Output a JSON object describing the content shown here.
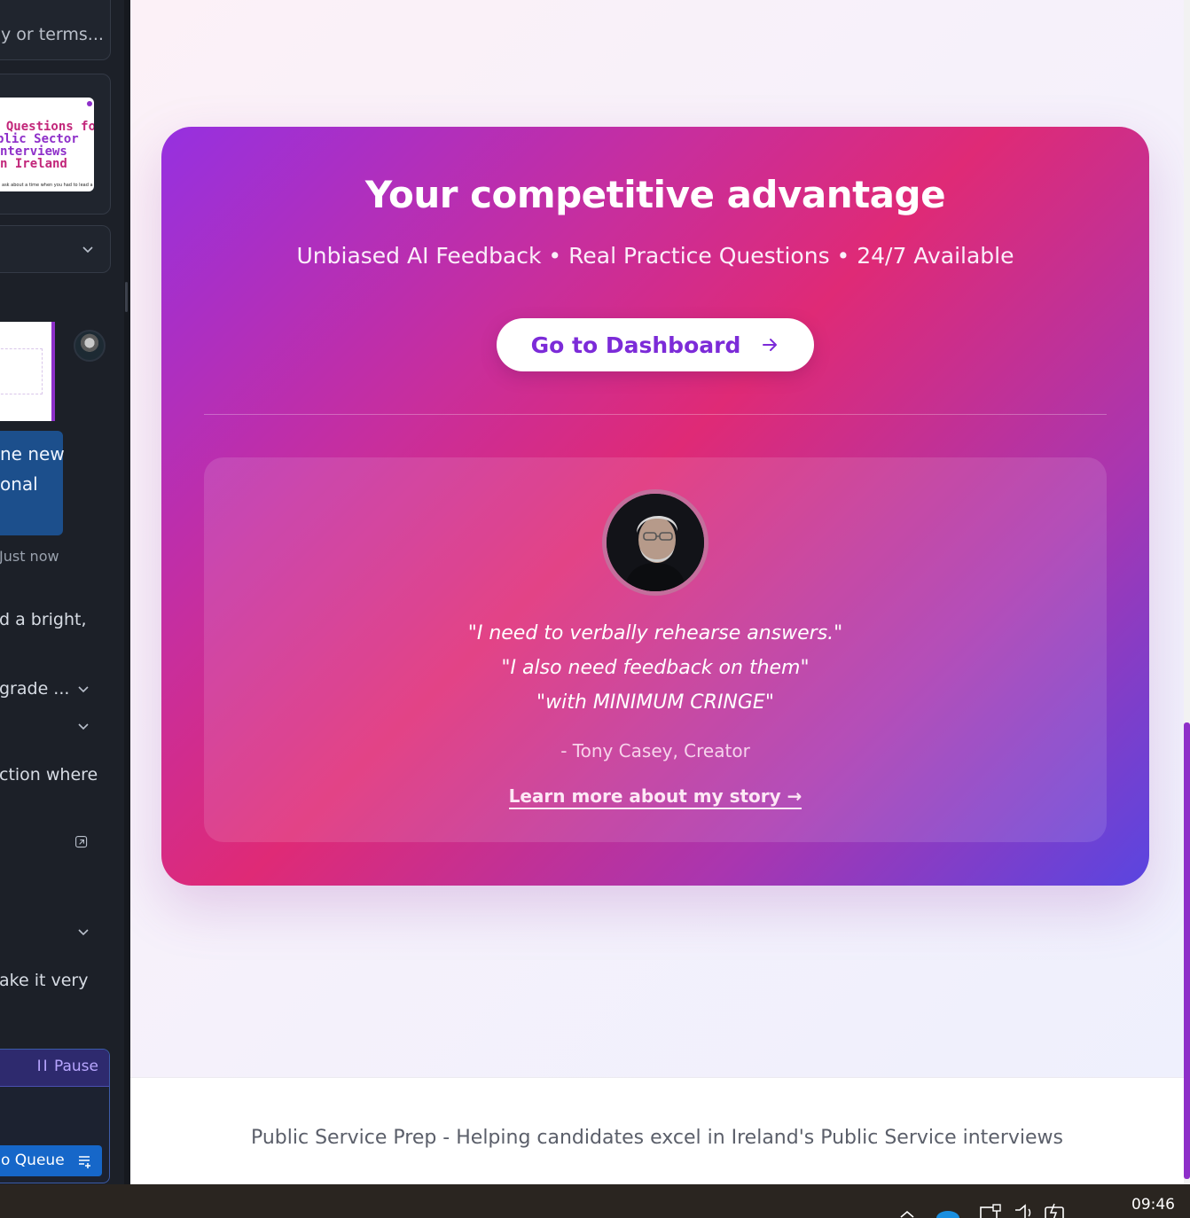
{
  "left_panel": {
    "search_fragment": "y or terms...",
    "thumbnail_lines": [
      "e Questions fo",
      "blic Sector",
      "nterviews",
      "n Ireland"
    ],
    "thumbnail_tiny": "ask about a time when you had to lead a",
    "bubble_lines": [
      "ne new",
      "onal"
    ],
    "bubble_time": "Just now",
    "text_bright": "d a bright,",
    "text_grade": "grade ...",
    "text_action": "ction where",
    "text_make": "ake it very",
    "pause_label": "Pause",
    "queue_label": "o Queue"
  },
  "cta": {
    "title": "Your competitive advantage",
    "subtitle": "Unbiased AI Feedback • Real Practice Questions • 24/7 Available",
    "button_label": "Go to Dashboard",
    "accent": "#7c2bd8",
    "gradient": [
      "#9630e0",
      "#df2a76",
      "#5a45e0"
    ]
  },
  "testimonial": {
    "quotes": [
      "\"I need to verbally rehearse answers.\"",
      "\"I also need feedback on them\"",
      "\"with MINIMUM CRINGE\""
    ],
    "attribution": "- Tony Casey, Creator",
    "link_label": "Learn more about my story →"
  },
  "footer": {
    "text": "Public Service Prep - Helping candidates excel in Ireland's Public Service interviews"
  },
  "taskbar": {
    "time": "09:46",
    "tray_icons": [
      "chevron-up-icon",
      "onedrive-icon",
      "network-icon",
      "volume-icon",
      "battery-charging-icon"
    ]
  }
}
